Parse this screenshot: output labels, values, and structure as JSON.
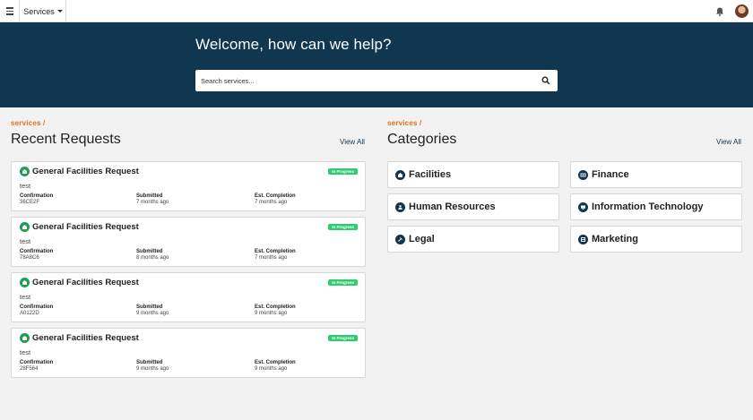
{
  "topbar": {
    "services_label": "Services"
  },
  "hero": {
    "title": "Welcome, how can we help?",
    "search_placeholder": "Search services..."
  },
  "colors": {
    "hero_bg": "#103650",
    "accent": "#e07020",
    "status_green": "#2ecc71",
    "icon_green": "#1f9d55"
  },
  "recent": {
    "crumb": "services /",
    "title": "Recent Requests",
    "view_all": "View All",
    "labels": {
      "confirmation": "Confirmation",
      "submitted": "Submitted",
      "est_completion": "Est. Completion"
    },
    "requests": [
      {
        "title": "General Facilities Request",
        "status": "In Progress",
        "description": "test",
        "confirmation": "36CE2F",
        "submitted": "7 months ago",
        "est_completion": "7 months ago"
      },
      {
        "title": "General Facilities Request",
        "status": "In Progress",
        "description": "test",
        "confirmation": "78A8C6",
        "submitted": "8 months ago",
        "est_completion": "7 months ago"
      },
      {
        "title": "General Facilities Request",
        "status": "In Progress",
        "description": "test",
        "confirmation": "A0122D",
        "submitted": "9 months ago",
        "est_completion": "9 months ago"
      },
      {
        "title": "General Facilities Request",
        "status": "In Progress",
        "description": "test",
        "confirmation": "28F564",
        "submitted": "9 months ago",
        "est_completion": "9 months ago"
      }
    ]
  },
  "categories": {
    "crumb": "services /",
    "title": "Categories",
    "view_all": "View All",
    "items": [
      {
        "label": "Facilities",
        "icon": "facilities-icon"
      },
      {
        "label": "Finance",
        "icon": "finance-icon"
      },
      {
        "label": "Human Resources",
        "icon": "human-resources-icon"
      },
      {
        "label": "Information Technology",
        "icon": "information-technology-icon"
      },
      {
        "label": "Legal",
        "icon": "legal-icon"
      },
      {
        "label": "Marketing",
        "icon": "marketing-icon"
      }
    ]
  }
}
